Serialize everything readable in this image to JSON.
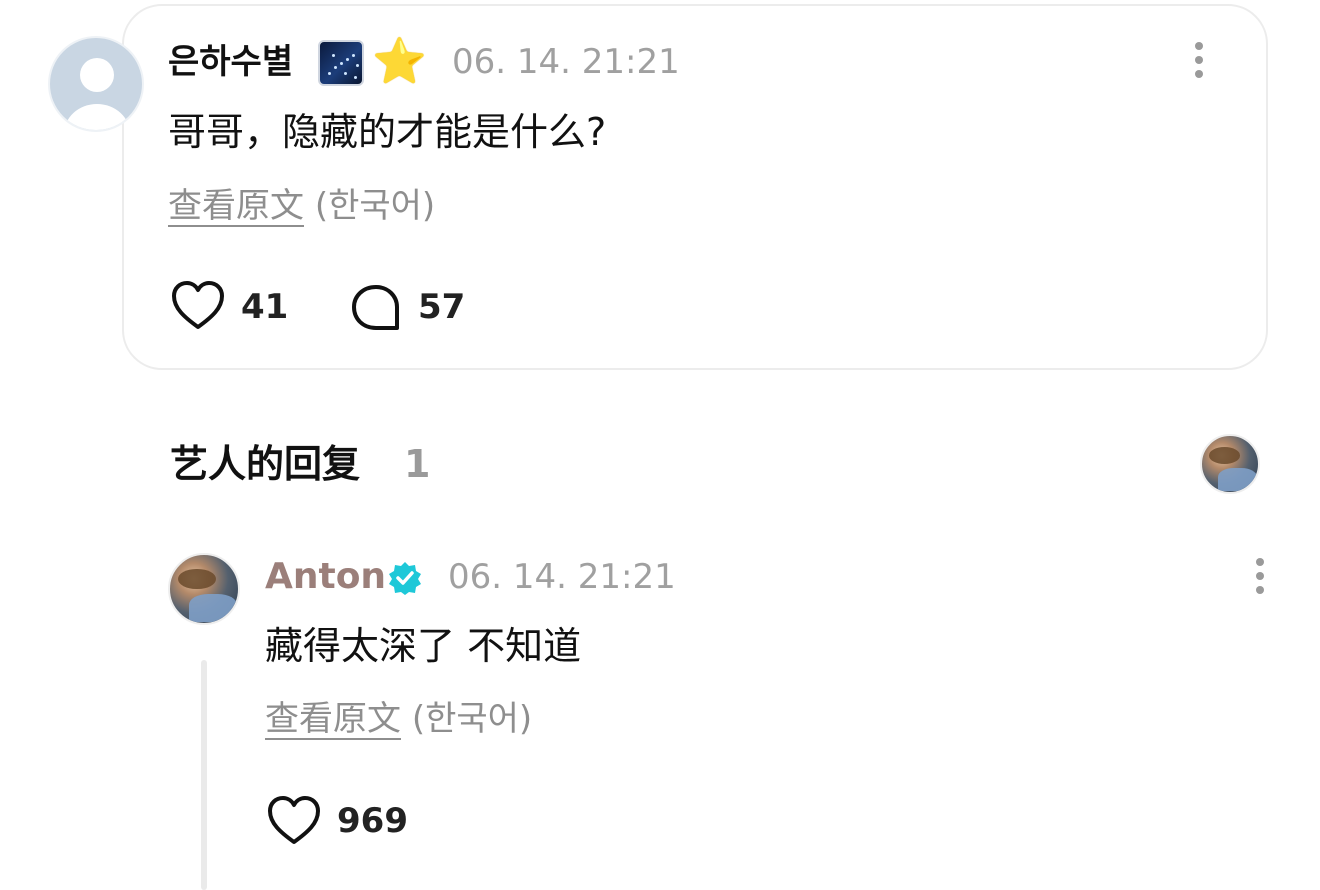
{
  "fan_comment": {
    "username": "은하수별",
    "timestamp": "06. 14. 21:21",
    "text": "哥哥，隐藏的才能是什么?",
    "translate_link": "查看原文",
    "language": "(한국어)",
    "likes": "41",
    "replies": "57",
    "badges": [
      "galaxy-emoji",
      "star-emoji"
    ],
    "badge_star_char": "⭐"
  },
  "artist_section": {
    "title": "艺人的回复",
    "count": "1"
  },
  "artist_reply": {
    "username": "Anton",
    "timestamp": "06. 14. 21:21",
    "text": "藏得太深了 不知道",
    "translate_link": "查看原文",
    "language": "(한국어)",
    "likes": "969"
  },
  "colors": {
    "artist_name": "#9b7f7a",
    "verified_badge": "#1ec8d8",
    "muted_text": "#a0a0a0",
    "card_border": "#ececec"
  },
  "icons": {
    "like": "heart-outline-icon",
    "reply": "speech-bubble-icon",
    "more": "vertical-dots-icon",
    "verified": "verified-check-icon"
  }
}
